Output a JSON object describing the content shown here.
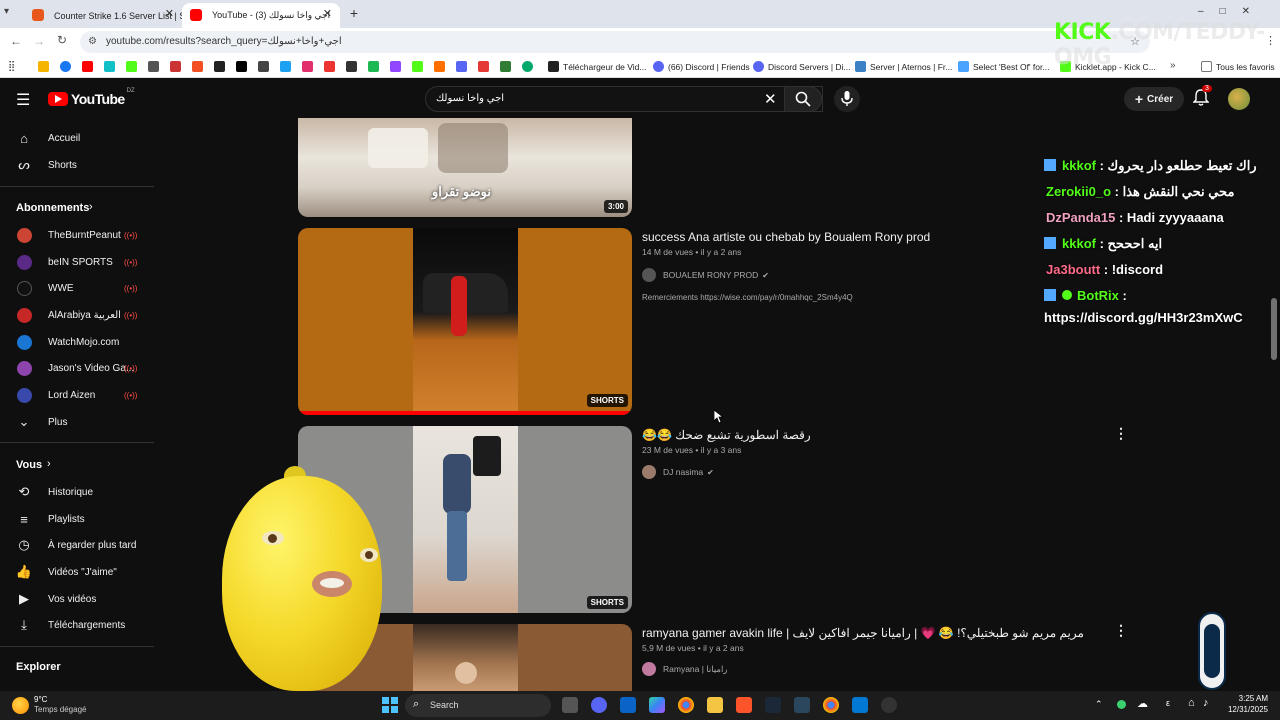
{
  "browser": {
    "tabs": [
      {
        "title": "Counter Strike 1.6 Server List | S",
        "active": false,
        "color": "#e8581c"
      },
      {
        "title": "YouTube - اجي واخا نسولك (3)",
        "active": true,
        "color": "#ff0000"
      }
    ],
    "new_tab": "+",
    "url": "youtube.com/results?search_query=اجي+واخا+نسولك",
    "bookmarks": [
      {
        "label": "Téléchargeur de Vid...",
        "color": "#222"
      },
      {
        "label": "(66) Discord | Friends",
        "color": "#5865f2"
      },
      {
        "label": "Discord Servers | Di...",
        "color": "#5865f2"
      },
      {
        "label": "Server | Aternos | Fr...",
        "color": "#3b82c4"
      },
      {
        "label": "Select 'Best Of' for...",
        "color": "#4aa3ff"
      },
      {
        "label": "Kicklet.app - Kick C...",
        "color": "#53fc18"
      },
      {
        "label": "Tous les favoris",
        "color": "#777"
      }
    ],
    "chevron": "»"
  },
  "overlay": {
    "kick_brand": "KICK",
    "kick_rest": ".COM/TEDDY-OMG"
  },
  "youtube": {
    "logo_text": "YouTube",
    "region": "DZ",
    "search_value": "اجي واخا نسولك",
    "create_label": "Créer",
    "notif_count": "3",
    "sidebar": {
      "home": "Accueil",
      "shorts": "Shorts",
      "subscriptions_title": "Abonnements",
      "channels": [
        {
          "name": "TheBurntPeanut",
          "color": "#c43"
        },
        {
          "name": "beIN SPORTS",
          "color": "#5b2a86"
        },
        {
          "name": "WWE",
          "color": "#111"
        },
        {
          "name": "AlArabiya العربية",
          "color": "#c62828"
        },
        {
          "name": "WatchMojo.com",
          "color": "#1976d2"
        },
        {
          "name": "Jason's Video Ga...",
          "color": "#8e44ad"
        },
        {
          "name": "Lord Aizen",
          "color": "#3949ab"
        }
      ],
      "more": "Plus",
      "you_title": "Vous",
      "you_items": [
        {
          "label": "Historique",
          "icon": "history-icon"
        },
        {
          "label": "Playlists",
          "icon": "playlist-icon"
        },
        {
          "label": "À regarder plus tard",
          "icon": "clock-icon"
        },
        {
          "label": "Vidéos \"J'aime\"",
          "icon": "like-icon"
        },
        {
          "label": "Vos vidéos",
          "icon": "video-icon"
        },
        {
          "label": "Téléchargements",
          "icon": "download-icon"
        }
      ],
      "explore_title": "Explorer"
    },
    "results": [
      {
        "thumb_caption": "نوضو تقراو",
        "badge": "3:00"
      },
      {
        "title": "success Ana artiste ou chebab by Boualem Rony prod",
        "meta": "14 M de vues • il y a 2 ans",
        "channel": "BOUALEM RONY PROD",
        "desc": "Remerciements https://wise.com/pay/r/0mahhqc_2Sm4y4Q",
        "badge": "SHORTS"
      },
      {
        "title": "😂😂 رقصة اسطورية تشبع ضحك",
        "meta": "23 M de vues • il y a 3 ans",
        "channel": "DJ nasima",
        "badge": "SHORTS"
      },
      {
        "title": "ramyana gamer avakin life | مريم مريم شو طبختيلي؟! 😂 💗 | راميانا جيمر افاكين لايف",
        "meta": "5,9 M de vues • il y a 2 ans",
        "channel": "Ramyana | راميانا"
      }
    ]
  },
  "chat": [
    {
      "user": "kkkof",
      "user_color": "#53fc18",
      "msg": " : راك تعيط حطلعو دار يحروك",
      "icon": true
    },
    {
      "user": "Zerokii0_o",
      "user_color": "#53fc18",
      "msg": " : محي نحي النقش هذا",
      "icon": false
    },
    {
      "user": "DzPanda15",
      "user_color": "#f0a0c0",
      "msg": " : Hadi zyyyaaana",
      "icon": false
    },
    {
      "user": "kkkof",
      "user_color": "#53fc18",
      "msg": " : ايه احححح",
      "icon": true
    },
    {
      "user": "Ja3boutt",
      "user_color": "#ff6b8a",
      "msg": " : !discord",
      "icon": false
    },
    {
      "user": "BotRix",
      "user_color": "#53fc18",
      "msg": " :",
      "icon": true
    },
    {
      "user": "",
      "user_color": "#fff",
      "msg": "https://discord.gg/HH3r23mXwC",
      "icon": false
    }
  ],
  "taskbar": {
    "weather_temp": "9°C",
    "weather_desc": "Temps dégagé",
    "search": "Search",
    "lang": "ε",
    "time": "3:25 AM",
    "date": "12/31/2025"
  }
}
